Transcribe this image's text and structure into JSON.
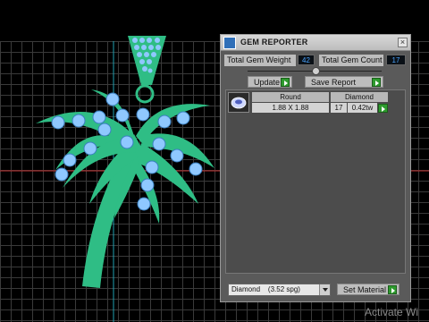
{
  "panel": {
    "title": "GEM REPORTER",
    "total_weight_label": "Total Gem Weight",
    "total_weight_value": "42",
    "total_count_label": "Total Gem Count",
    "total_count_value": "17",
    "update_label": "Update",
    "save_report_label": "Save Report"
  },
  "table": {
    "headers": [
      "Round",
      "Diamond"
    ],
    "rows": [
      {
        "size": "1.88 X 1.88",
        "count": "17",
        "weight": "0.42tw"
      }
    ]
  },
  "material": {
    "selected": "Diamond    (3.52 spg)",
    "set_label": "Set Material"
  },
  "watermark": "Activate Wi",
  "colors": {
    "model": "#2fbd85",
    "gem": "#8fc8ff",
    "grid": "#3a3a3a",
    "axis_red": "#c03030",
    "axis_cyan": "#20a0b0"
  }
}
